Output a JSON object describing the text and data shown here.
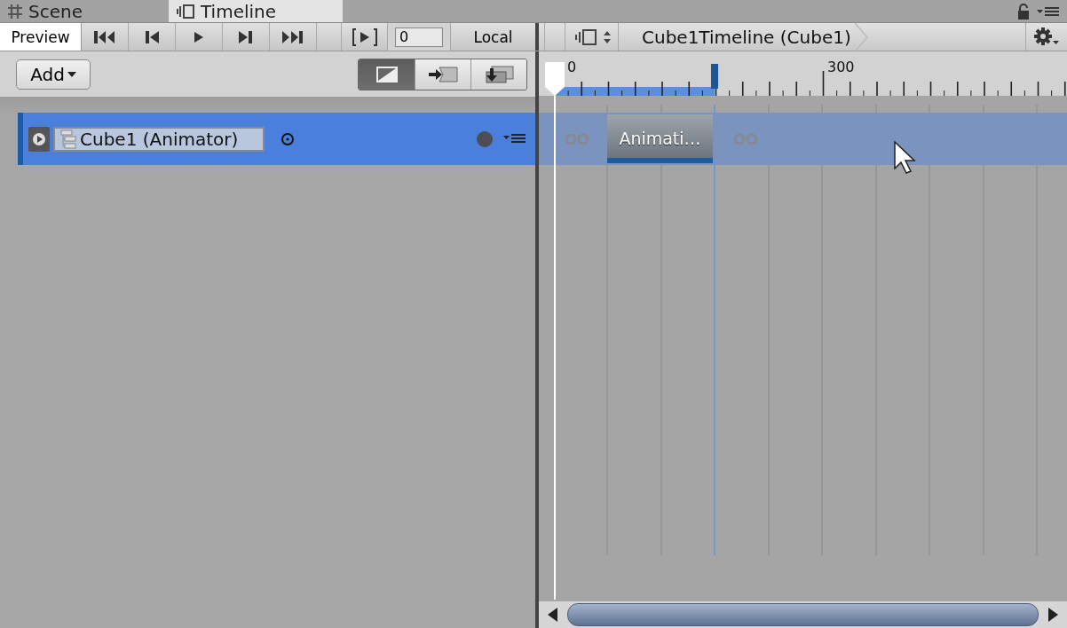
{
  "tabs": [
    {
      "label": "Scene",
      "kind": "grid",
      "selected": false
    },
    {
      "label": "Timeline",
      "kind": "timeline",
      "selected": true
    }
  ],
  "toolbar": {
    "preview": {
      "label": "Preview",
      "selected": true
    },
    "transport": [
      {
        "kind": "first"
      },
      {
        "kind": "prev"
      },
      {
        "kind": "play"
      },
      {
        "kind": "next"
      },
      {
        "kind": "last"
      }
    ],
    "frame_field": {
      "value": "0"
    },
    "time_mode": "Local",
    "breadcrumb": "Cube1Timeline (Cube1)"
  },
  "add_button": "Add",
  "view_modes": [
    {
      "kind": "curves",
      "selected": true
    },
    {
      "kind": "mix",
      "selected": false
    },
    {
      "kind": "replace",
      "selected": false
    }
  ],
  "ruler": {
    "labels": [
      "0",
      "300"
    ]
  },
  "tracks": [
    {
      "name": "Cube1 (Animator)",
      "selected": true,
      "clips": [
        {
          "label": "Animati…"
        }
      ]
    }
  ]
}
